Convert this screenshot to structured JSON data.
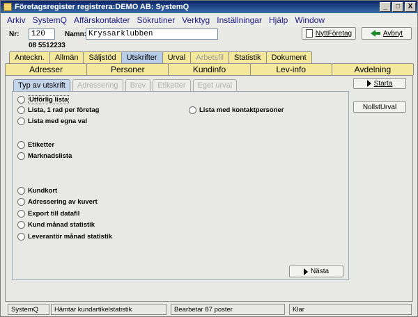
{
  "window": {
    "title": "Företagsregister registrera:DEMO AB: SystemQ",
    "controls": [
      "_",
      "□",
      "X"
    ]
  },
  "menu": [
    "Arkiv",
    "SystemQ",
    "Affärskontakter",
    "Sökrutiner",
    "Verktyg",
    "Inställningar",
    "Hjälp",
    "Window"
  ],
  "header": {
    "nr_label": "Nr:",
    "nr_value": "120",
    "namn_label": "Namn:",
    "namn_value": "Kryssarklubben",
    "phone": "08 5512233",
    "new_company_button": "NyttFöretag",
    "cancel_button": "Avbryt"
  },
  "tabs_row1": [
    {
      "label": "Anteckn.",
      "state": "normal"
    },
    {
      "label": "Allmän",
      "state": "normal"
    },
    {
      "label": "Säljstöd",
      "state": "normal"
    },
    {
      "label": "Utskrifter",
      "state": "active"
    },
    {
      "label": "Urval",
      "state": "normal"
    },
    {
      "label": "Arbetsfil",
      "state": "disabled"
    },
    {
      "label": "Statistik",
      "state": "normal"
    },
    {
      "label": "Dokument",
      "state": "normal"
    }
  ],
  "tabs_row2": [
    "Adresser",
    "Personer",
    "Kundinfo",
    "Lev-info",
    "Avdelning"
  ],
  "inner_tabs": [
    {
      "label": "Typ av utskrift",
      "state": "active"
    },
    {
      "label": "Adressering",
      "state": "disabled"
    },
    {
      "label": "Brev",
      "state": "disabled"
    },
    {
      "label": "Etiketter",
      "state": "disabled"
    },
    {
      "label": "Eget urval",
      "state": "disabled"
    }
  ],
  "radios": {
    "utforlig_lista": "Utförlig lista",
    "lista_1_rad": "Lista, 1 rad per företag",
    "lista_kontaktpersoner": "Lista med kontaktpersoner",
    "lista_egna_val": "Lista med egna val",
    "etiketter": "Etiketter",
    "marknadslista": "Marknadslista",
    "kundkort": "Kundkort",
    "adressering_kuvert": "Adressering av kuvert",
    "export_datafil": "Export till datafil",
    "kund_manad_statistik": "Kund månad statistik",
    "leverantor_manad_statistik": "Leverantör månad statistik"
  },
  "buttons": {
    "starta": "Starta",
    "nollst_urval": "NollstUrval",
    "nasta": "Nästa"
  },
  "status": [
    "SystemQ",
    "Hämtar kundartikelstatistik",
    "Bearbetar 87 poster",
    "Klar"
  ],
  "colors": {
    "tab_yellow": "#f3e89c",
    "tab_active_blue": "#b8cde8",
    "menu_text": "#1a1a8a",
    "title_bar": "#0a246a"
  }
}
